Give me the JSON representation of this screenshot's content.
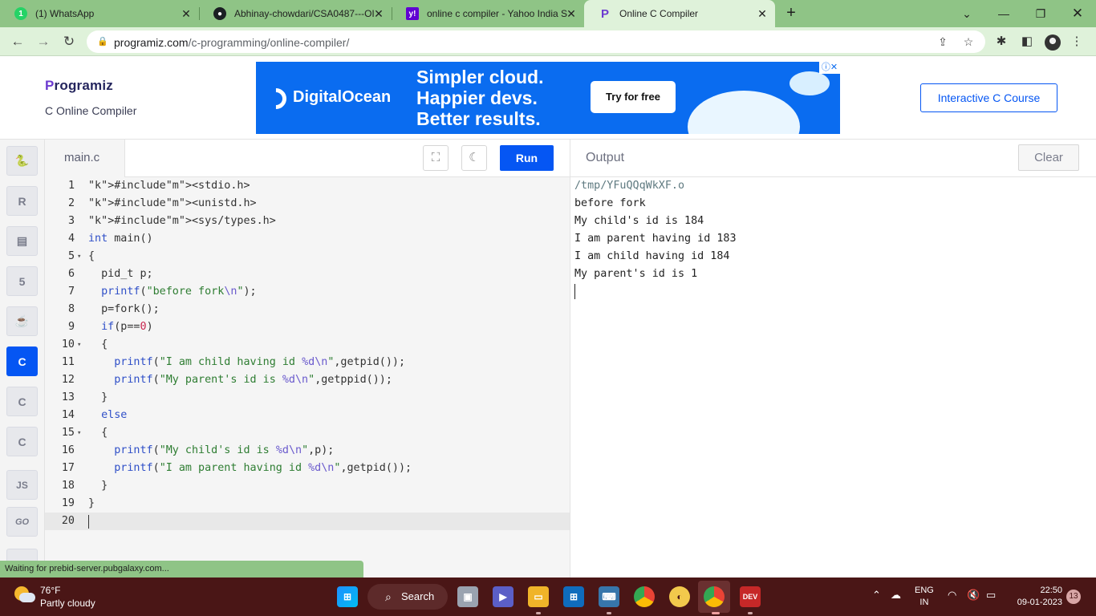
{
  "browser": {
    "tabs": [
      {
        "title": "(1) WhatsApp",
        "icon": "whatsapp-icon",
        "color": "#25d366"
      },
      {
        "title": "Abhinay-chowdari/CSA0487---OI",
        "icon": "github-icon",
        "color": "#1b1f23"
      },
      {
        "title": "online c compiler - Yahoo India S",
        "icon": "yahoo-icon",
        "color": "#6001d2"
      },
      {
        "title": "Online C Compiler",
        "icon": "programiz-icon",
        "color": "#6c3bd0"
      }
    ],
    "url_host": "programiz.com",
    "url_path": "/c-programming/online-compiler/"
  },
  "header": {
    "logo_p": "P",
    "logo_rest": "rogramiz",
    "subtitle": "C Online Compiler",
    "course_button": "Interactive C Course"
  },
  "ad": {
    "brand": "DigitalOcean",
    "line1": "Simpler cloud.",
    "line2": "Happier devs.",
    "line3": "Better results.",
    "cta": "Try for free"
  },
  "sidebar": {
    "languages": [
      {
        "name": "python",
        "glyph": "🐍",
        "active": false
      },
      {
        "name": "r",
        "glyph": "R",
        "active": false
      },
      {
        "name": "sql",
        "glyph": "▤",
        "active": false
      },
      {
        "name": "html",
        "glyph": "5",
        "active": false
      },
      {
        "name": "java",
        "glyph": "☕",
        "active": false
      },
      {
        "name": "c",
        "glyph": "C",
        "active": true
      },
      {
        "name": "cpp",
        "glyph": "C",
        "active": false
      },
      {
        "name": "csharp",
        "glyph": "C",
        "active": false
      },
      {
        "name": "javascript",
        "glyph": "JS",
        "active": false
      },
      {
        "name": "go",
        "glyph": "GO",
        "active": false
      }
    ]
  },
  "editor": {
    "filename": "main.c",
    "run_label": "Run",
    "fold_lines": [
      5,
      10,
      15
    ],
    "current_line": 20,
    "lines": [
      "#include<stdio.h>",
      "#include<unistd.h>",
      "#include<sys/types.h>",
      "int main()",
      "{",
      "  pid_t p;",
      "  printf(\"before fork\\n\");",
      "  p=fork();",
      "  if(p==0)",
      "  {",
      "    printf(\"I am child having id %d\\n\",getpid());",
      "    printf(\"My parent's id is %d\\n\",getppid());",
      "  }",
      "  else",
      "  {",
      "    printf(\"My child's id is %d\\n\",p);",
      "    printf(\"I am parent having id %d\\n\",getpid());",
      "  }",
      "}",
      ""
    ]
  },
  "output": {
    "title": "Output",
    "clear_label": "Clear",
    "lines": [
      "/tmp/YFuQQqWkXF.o",
      "before fork",
      "My child's id is 184",
      "I am parent having id 183",
      "I am child having id 184",
      "My parent's id is 1"
    ]
  },
  "status": {
    "text": "Waiting for prebid-server.pubgalaxy.com..."
  },
  "taskbar": {
    "temperature": "76°F",
    "weather": "Partly cloudy",
    "search_label": "Search",
    "lang_line1": "ENG",
    "lang_line2": "IN",
    "time": "22:50",
    "date": "09-01-2023",
    "notifications": "13"
  },
  "colors": {
    "accent": "#0556f3",
    "tabstrip": "#8fc486",
    "taskbar": "#4a1616"
  }
}
